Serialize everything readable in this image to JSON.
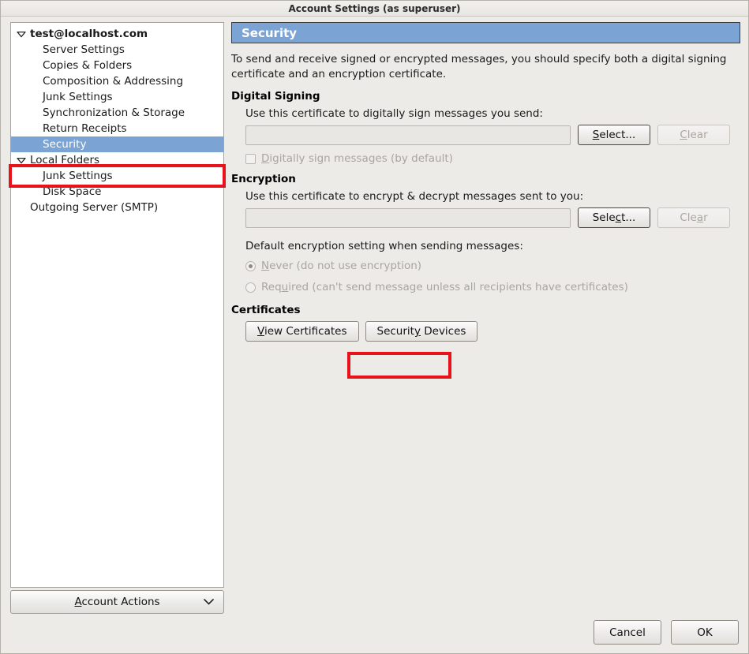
{
  "window": {
    "title": "Account Settings (as superuser)"
  },
  "sidebar": {
    "items": [
      {
        "label": "test@localhost.com",
        "level": 0,
        "root": true,
        "twisty": "chevron-down-icon",
        "selected": false
      },
      {
        "label": "Server Settings",
        "level": 1,
        "root": false,
        "twisty": "",
        "selected": false
      },
      {
        "label": "Copies & Folders",
        "level": 1,
        "root": false,
        "twisty": "",
        "selected": false
      },
      {
        "label": "Composition & Addressing",
        "level": 1,
        "root": false,
        "twisty": "",
        "selected": false
      },
      {
        "label": "Junk Settings",
        "level": 1,
        "root": false,
        "twisty": "",
        "selected": false
      },
      {
        "label": "Synchronization & Storage",
        "level": 1,
        "root": false,
        "twisty": "",
        "selected": false
      },
      {
        "label": "Return Receipts",
        "level": 1,
        "root": false,
        "twisty": "",
        "selected": false
      },
      {
        "label": "Security",
        "level": 1,
        "root": false,
        "twisty": "",
        "selected": true
      },
      {
        "label": "Local Folders",
        "level": 0,
        "root": false,
        "twisty": "chevron-down-icon",
        "selected": false
      },
      {
        "label": "Junk Settings",
        "level": 1,
        "root": false,
        "twisty": "",
        "selected": false
      },
      {
        "label": "Disk Space",
        "level": 1,
        "root": false,
        "twisty": "",
        "selected": false
      },
      {
        "label": "Outgoing Server (SMTP)",
        "level": 0,
        "root": false,
        "twisty": "",
        "selected": false
      }
    ],
    "account_actions": {
      "label": "Account Actions",
      "mnemonic": "A",
      "chevron": "chevron-down-icon"
    }
  },
  "main": {
    "header": "Security",
    "intro": "To send and receive signed or encrypted messages, you should specify both a digital signing certificate and an encryption certificate.",
    "digital_signing": {
      "title": "Digital Signing",
      "field_label": "Use this certificate to digitally sign messages you send:",
      "cert_value": "",
      "select_label": "Select...",
      "select_mnemonic": "S",
      "clear_label": "Clear",
      "clear_mnemonic": "C",
      "clear_disabled": true,
      "checkbox_label": "Digitally sign messages (by default)",
      "checkbox_mnemonic": "D",
      "checkbox_checked": false,
      "checkbox_disabled": true
    },
    "encryption": {
      "title": "Encryption",
      "field_label": "Use this certificate to encrypt & decrypt messages sent to you:",
      "cert_value": "",
      "select_label": "Select...",
      "select_mnemonic": "c",
      "clear_label": "Clear",
      "clear_mnemonic": "a",
      "clear_disabled": true,
      "default_setting_label": "Default encryption setting when sending messages:",
      "options": [
        {
          "label": "Never (do not use encryption)",
          "mnemonic": "N",
          "selected": true,
          "disabled": true
        },
        {
          "label": "Required (can't send message unless all recipients have certificates)",
          "mnemonic": "u",
          "selected": false,
          "disabled": true
        }
      ]
    },
    "certificates": {
      "title": "Certificates",
      "view_label": "View Certificates",
      "view_mnemonic": "V",
      "devices_label": "Security Devices",
      "devices_mnemonic": "y",
      "devices_highlighted": true
    }
  },
  "footer": {
    "cancel_label": "Cancel",
    "ok_label": "OK"
  },
  "colors": {
    "accent_blue": "#7ba3d4",
    "annotation_red": "#e8131a",
    "window_bg": "#edebe7",
    "tree_bg": "#ffffff",
    "disabled_text": "#a9a5a0"
  }
}
